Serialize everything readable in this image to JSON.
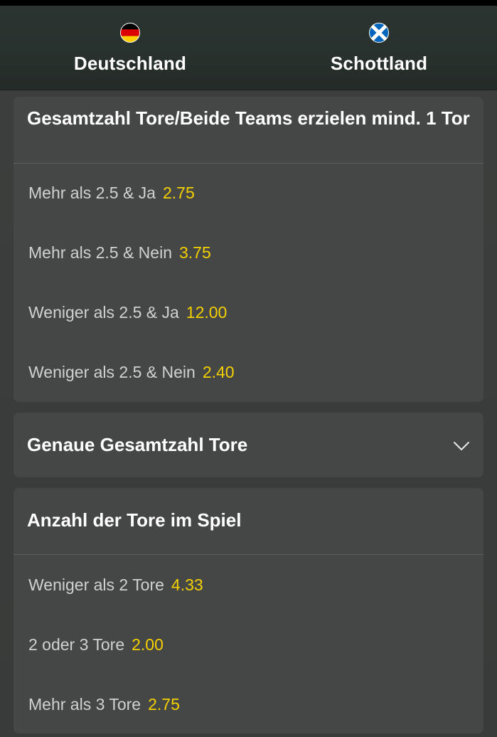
{
  "teams": {
    "home": {
      "name": "Deutschland",
      "flag": "germany-flag"
    },
    "away": {
      "name": "Schottland",
      "flag": "scotland-flag"
    }
  },
  "colors": {
    "odds": "#f5d000",
    "card_bg": "#454746",
    "header_bg": "#28312d",
    "label": "#d0d2d1"
  },
  "markets": [
    {
      "title": "Gesamtzahl Tore/Beide Teams erzielen mind. 1 Tor",
      "expanded": true,
      "selections": [
        {
          "label": "Mehr als 2.5 & Ja",
          "odds": "2.75"
        },
        {
          "label": "Mehr als 2.5 & Nein",
          "odds": "3.75"
        },
        {
          "label": "Weniger als 2.5 & Ja",
          "odds": "12.00"
        },
        {
          "label": "Weniger als 2.5 & Nein",
          "odds": "2.40"
        }
      ]
    },
    {
      "title": "Genaue Gesamtzahl Tore",
      "expanded": false,
      "icon": "chevron-down-icon",
      "selections": []
    },
    {
      "title": "Anzahl der Tore im Spiel",
      "expanded": true,
      "selections": [
        {
          "label": "Weniger als 2 Tore",
          "odds": "4.33"
        },
        {
          "label": "2 oder 3 Tore",
          "odds": "2.00"
        },
        {
          "label": "Mehr als 3 Tore",
          "odds": "2.75"
        }
      ]
    }
  ]
}
